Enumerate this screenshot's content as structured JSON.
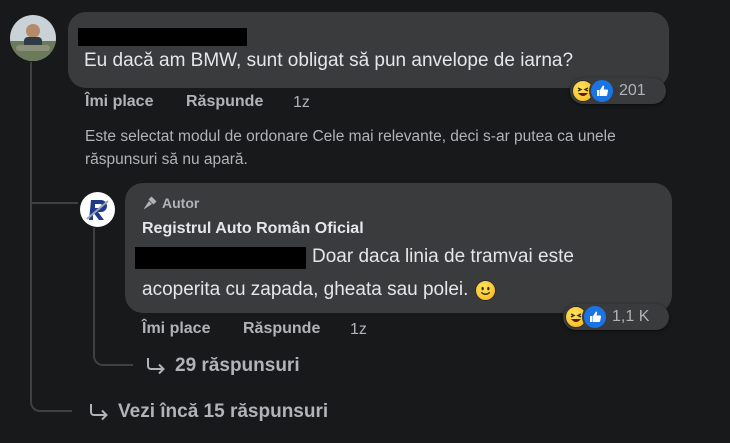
{
  "comment1": {
    "text": "Eu dacă am BMW, sunt obligat să pun anvelope de iarna?",
    "like_label": "Îmi place",
    "reply_label": "Răspunde",
    "time": "1z",
    "reaction_count": "201"
  },
  "sort_notice": {
    "line1": "Este selectat modul de ordonare Cele mai relevante, deci s-ar putea ca unele",
    "line2": "răspunsuri să nu apară."
  },
  "comment2": {
    "badge": "Autor",
    "author": "Registrul Auto Român Oficial",
    "text_line1": "Doar daca linia de tramvai este",
    "text_line2": "acoperita cu zapada, gheata sau polei.",
    "like_label": "Îmi place",
    "reply_label": "Răspunde",
    "time": "1z",
    "reaction_count": "1,1 K"
  },
  "replies_link": "29 răspunsuri",
  "more_replies_link": "Vezi încă 15 răspunsuri",
  "colors": {
    "background": "#18191a",
    "bubble": "#3a3b3c",
    "text": "#e4e6eb",
    "muted": "#b0b3b8",
    "like_blue": "#1b74e4"
  }
}
